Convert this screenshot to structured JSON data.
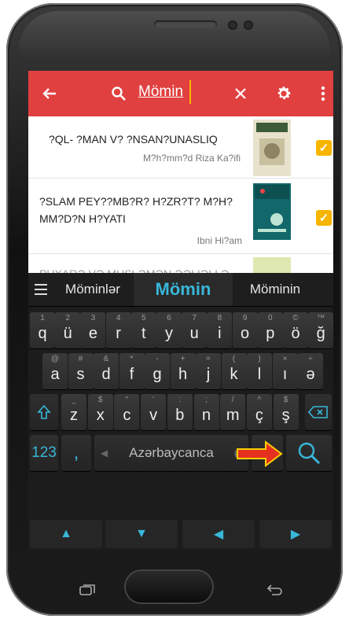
{
  "appbar": {
    "search_value": "Mömin",
    "back_icon": "arrow-left-icon",
    "search_icon": "search-icon",
    "clear_icon": "close-icon",
    "settings_icon": "gear-icon",
    "more_icon": "more-vert-icon",
    "color": "#e0403f"
  },
  "results": [
    {
      "title": "?QL- ?MAN V? ?NSAN?UNASLIQ",
      "author": "M?h?mm?d Riza Ka?ifi",
      "checked": true
    },
    {
      "title": "?SLAM PEY??MB?R? H?ZR?T? M?H?MM?D?N H?YATI",
      "author": "Ibni Hi?am",
      "checked": true
    },
    {
      "title": "PUXARƏ VƏ MUSLƏMƏN ƏƏLIƏLI Ə",
      "author": "",
      "checked": false
    }
  ],
  "keyboard": {
    "suggestions": [
      "Möminlər",
      "Mömin",
      "Möminin"
    ],
    "row1": [
      {
        "k": "q",
        "s": "1"
      },
      {
        "k": "ü",
        "s": "2"
      },
      {
        "k": "e",
        "s": "3"
      },
      {
        "k": "r",
        "s": "4"
      },
      {
        "k": "t",
        "s": "5"
      },
      {
        "k": "y",
        "s": "6"
      },
      {
        "k": "u",
        "s": "7"
      },
      {
        "k": "i",
        "s": "8"
      },
      {
        "k": "o",
        "s": "9"
      },
      {
        "k": "p",
        "s": "0"
      },
      {
        "k": "ö",
        "s": "©"
      },
      {
        "k": "ğ",
        "s": "™"
      }
    ],
    "row2": [
      {
        "k": "a",
        "s": "@"
      },
      {
        "k": "s",
        "s": "#"
      },
      {
        "k": "d",
        "s": "&"
      },
      {
        "k": "f",
        "s": "*"
      },
      {
        "k": "g",
        "s": "-"
      },
      {
        "k": "h",
        "s": "+"
      },
      {
        "k": "j",
        "s": "="
      },
      {
        "k": "k",
        "s": "("
      },
      {
        "k": "l",
        "s": ")"
      },
      {
        "k": "ı",
        "s": "×"
      },
      {
        "k": "ə",
        "s": "÷"
      }
    ],
    "row3": [
      {
        "k": "z",
        "s": "_"
      },
      {
        "k": "x",
        "s": "$"
      },
      {
        "k": "c",
        "s": "\""
      },
      {
        "k": "v",
        "s": "'"
      },
      {
        "k": "b",
        "s": ":"
      },
      {
        "k": "n",
        "s": ";"
      },
      {
        "k": "m",
        "s": "/"
      },
      {
        "k": "ç",
        "s": "^"
      },
      {
        "k": "ş",
        "s": "$"
      }
    ],
    "numbers_label": "123",
    "comma_label": ",",
    "space_label": "Azərbaycanca",
    "period_label": ".",
    "accent_color": "#38b7d8"
  }
}
